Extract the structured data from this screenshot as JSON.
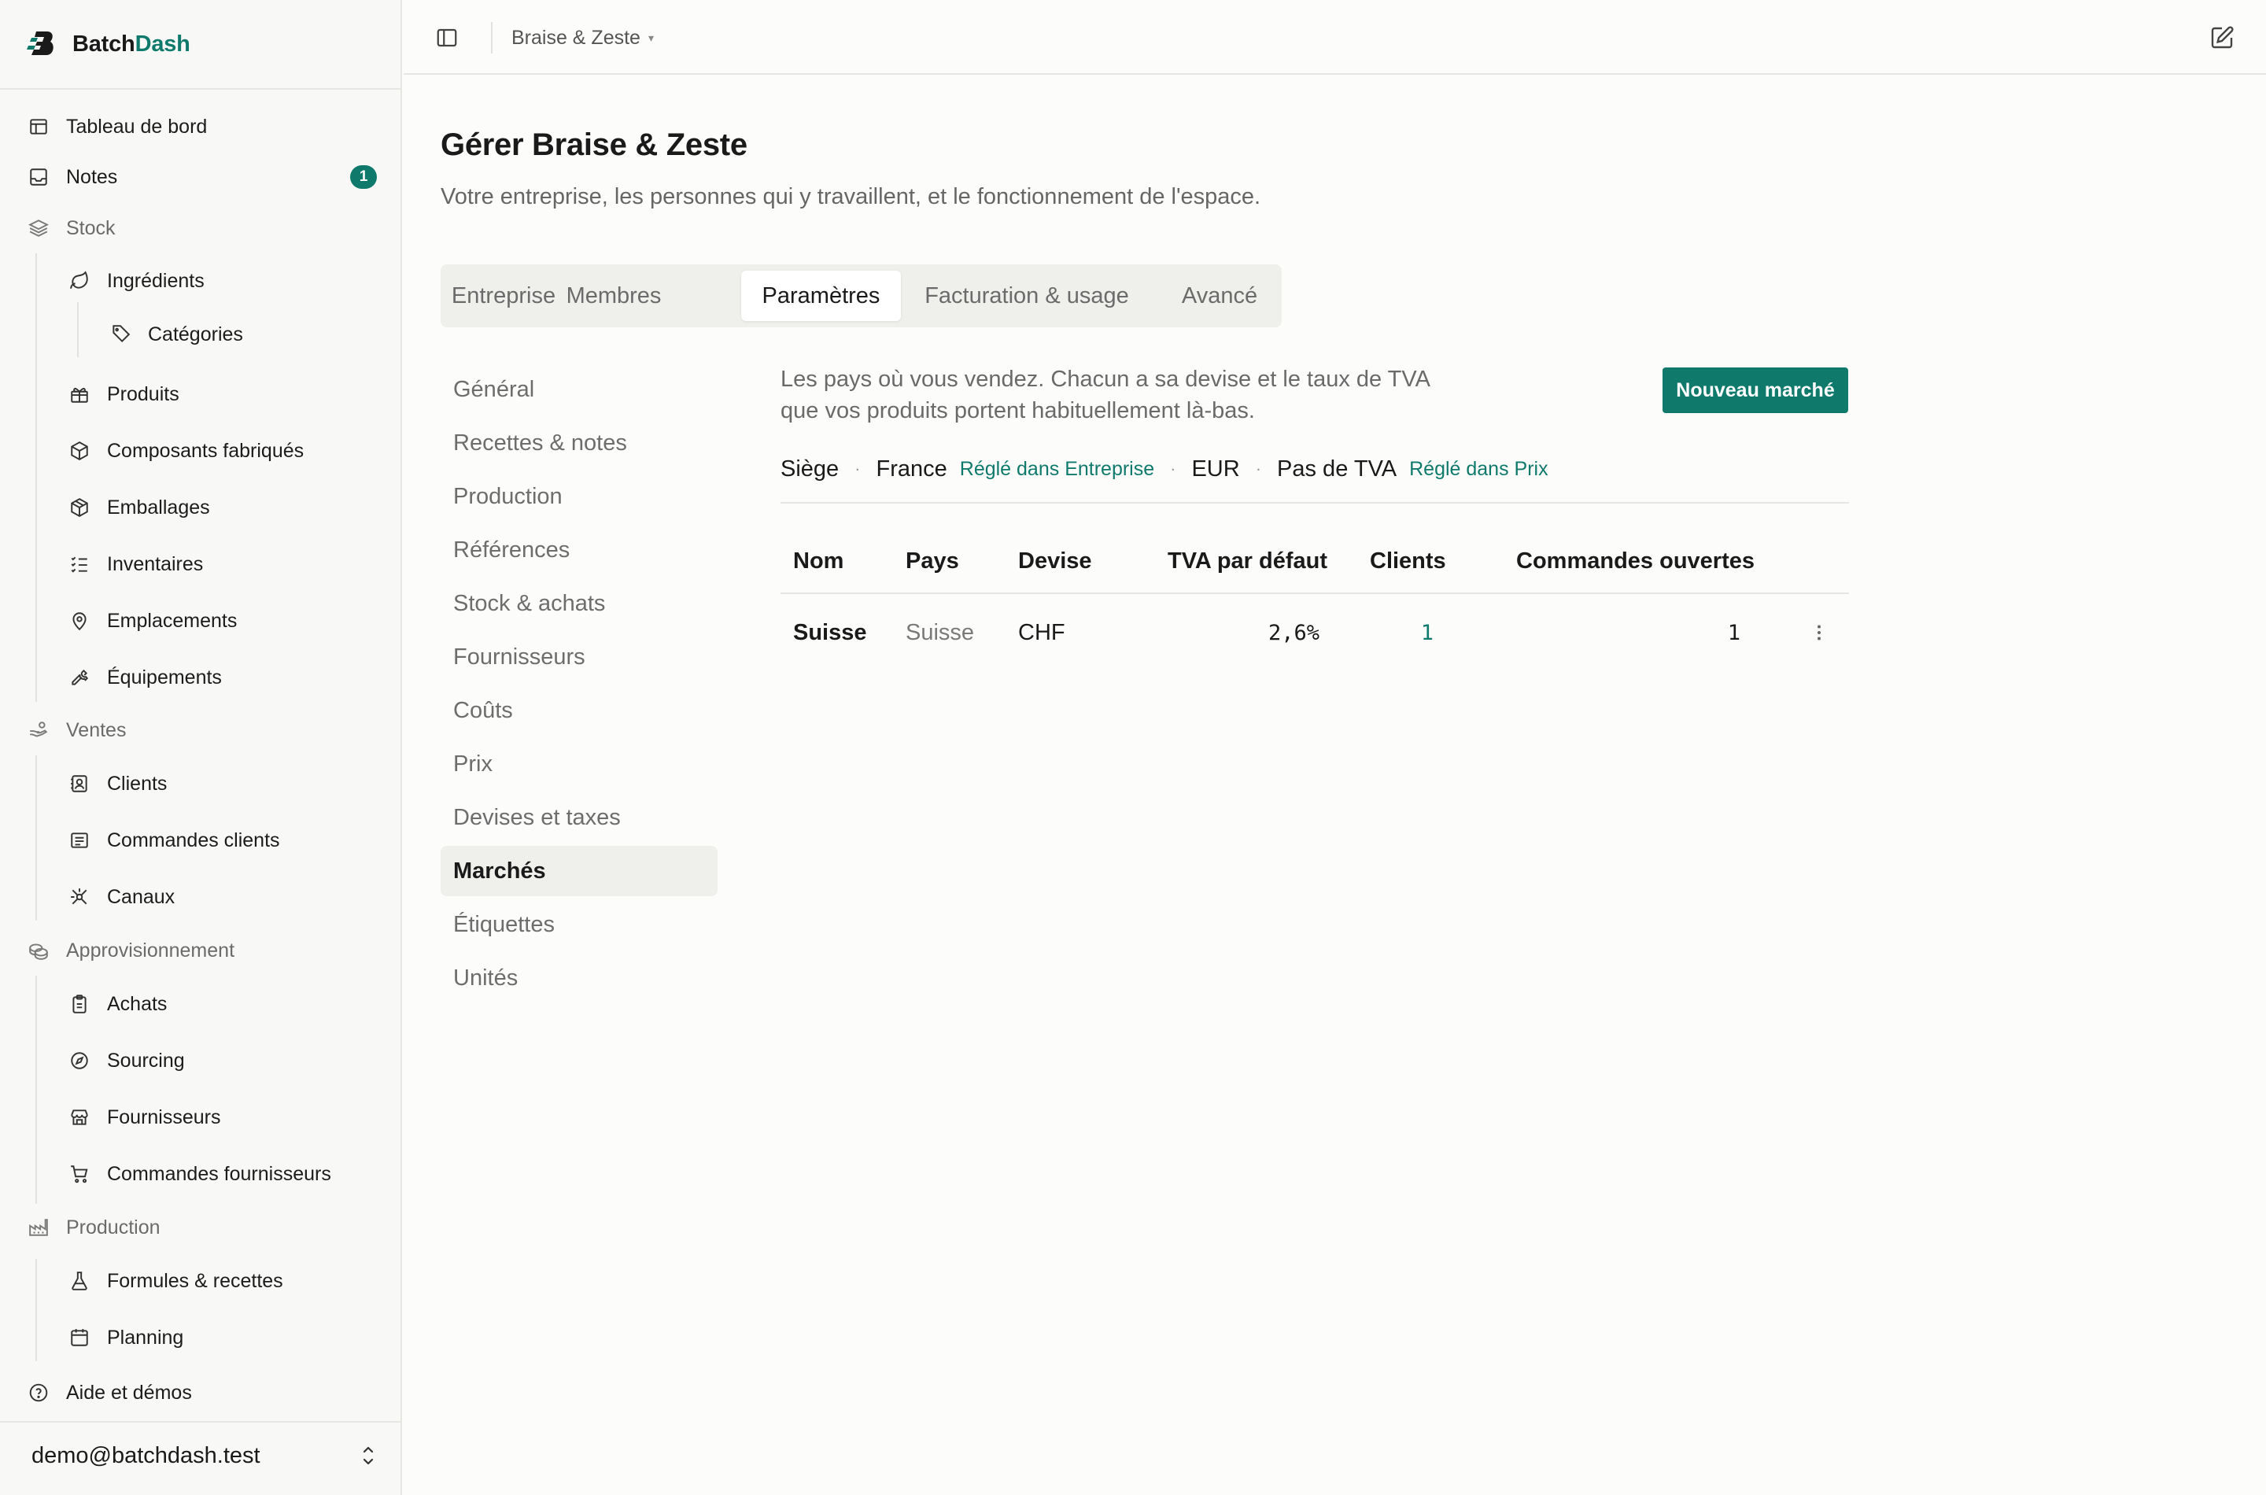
{
  "app": {
    "name_prefix": "Batch",
    "name_suffix": "Dash",
    "accent_color": "#0f7a6c"
  },
  "sidebar": {
    "items": [
      {
        "label": "Tableau de bord",
        "icon": "table-icon"
      },
      {
        "label": "Notes",
        "icon": "inbox-icon",
        "badge": "1"
      },
      {
        "label": "Stock",
        "icon": "layers-icon",
        "section": true
      },
      {
        "label": "Ingrédients",
        "icon": "leaf-icon"
      },
      {
        "label": "Catégories",
        "icon": "tag-icon"
      },
      {
        "label": "Produits",
        "icon": "gift-icon"
      },
      {
        "label": "Composants fabriqués",
        "icon": "cube-icon"
      },
      {
        "label": "Emballages",
        "icon": "package-icon"
      },
      {
        "label": "Inventaires",
        "icon": "checklist-icon"
      },
      {
        "label": "Emplacements",
        "icon": "map-pin-icon"
      },
      {
        "label": "Équipements",
        "icon": "wrench-icon"
      },
      {
        "label": "Ventes",
        "icon": "hand-coins-icon",
        "section": true
      },
      {
        "label": "Clients",
        "icon": "contact-icon"
      },
      {
        "label": "Commandes clients",
        "icon": "receipt-icon"
      },
      {
        "label": "Canaux",
        "icon": "network-icon"
      },
      {
        "label": "Approvisionnement",
        "icon": "coins-icon",
        "section": true
      },
      {
        "label": "Achats",
        "icon": "clipboard-icon"
      },
      {
        "label": "Sourcing",
        "icon": "compass-icon"
      },
      {
        "label": "Fournisseurs",
        "icon": "store-icon"
      },
      {
        "label": "Commandes fournisseurs",
        "icon": "cart-icon"
      },
      {
        "label": "Production",
        "icon": "factory-icon",
        "section": true
      },
      {
        "label": "Formules & recettes",
        "icon": "flask-icon"
      },
      {
        "label": "Planning",
        "icon": "calendar-icon"
      },
      {
        "label": "Aide et démos",
        "icon": "help-icon"
      }
    ],
    "user_email": "demo@batchdash.test"
  },
  "topbar": {
    "workspace": "Braise & Zeste"
  },
  "page": {
    "title": "Gérer Braise & Zeste",
    "subtitle": "Votre entreprise, les personnes qui y travaillent, et le fonctionnement de l'espace."
  },
  "tabs": [
    {
      "label": "Entreprise"
    },
    {
      "label": "Membres"
    },
    {
      "label": "Paramètres",
      "active": true
    },
    {
      "label": "Facturation & usage"
    },
    {
      "label": "Avancé"
    }
  ],
  "subnav": [
    {
      "label": "Général"
    },
    {
      "label": "Recettes & notes"
    },
    {
      "label": "Production"
    },
    {
      "label": "Références"
    },
    {
      "label": "Stock & achats"
    },
    {
      "label": "Fournisseurs"
    },
    {
      "label": "Coûts"
    },
    {
      "label": "Prix"
    },
    {
      "label": "Devises et taxes"
    },
    {
      "label": "Marchés",
      "active": true
    },
    {
      "label": "Étiquettes"
    },
    {
      "label": "Unités"
    }
  ],
  "markets": {
    "description_line1": "Les pays où vous vendez. Chacun a sa devise et le taux de TVA",
    "description_line2": "que vos produits portent habituellement là-bas.",
    "new_button": "Nouveau marché",
    "hq": {
      "label": "Siège",
      "country": "France",
      "country_link": "Réglé dans Entreprise",
      "currency": "EUR",
      "vat": "Pas de TVA",
      "vat_link": "Réglé dans Prix"
    },
    "columns": [
      "Nom",
      "Pays",
      "Devise",
      "TVA par défaut",
      "Clients",
      "Commandes ouvertes"
    ],
    "rows": [
      {
        "name": "Suisse",
        "country": "Suisse",
        "currency": "CHF",
        "vat": "2,6%",
        "clients": "1",
        "open_orders": "1"
      }
    ]
  }
}
